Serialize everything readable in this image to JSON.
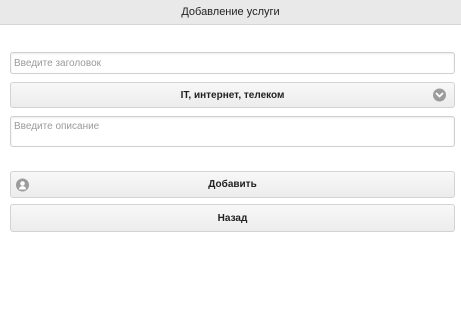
{
  "header": {
    "title": "Добавление услуги"
  },
  "form": {
    "title_placeholder": "Введите заголовок",
    "title_value": "",
    "category_selected": "IT, интернет, телеком",
    "description_placeholder": "Введите описание",
    "description_value": ""
  },
  "buttons": {
    "add_label": "Добавить",
    "back_label": "Назад"
  },
  "icons": {
    "select_icon": "chevron-down-icon",
    "add_icon": "user-icon"
  },
  "colors": {
    "header_bg": "#e9e9e9",
    "icon_gray": "#9c9c9c"
  }
}
